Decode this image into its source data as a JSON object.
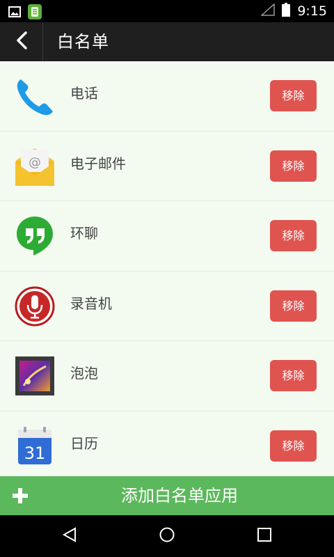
{
  "status_bar": {
    "time": "9:15",
    "left_icons": [
      "image-icon",
      "android-notification-icon"
    ],
    "right_icons": [
      "signal-icon",
      "battery-icon"
    ]
  },
  "title_bar": {
    "title": "白名单",
    "back_icon": "back-arrow-icon"
  },
  "apps": [
    {
      "name": "电话",
      "icon": "phone-icon",
      "remove_label": "移除"
    },
    {
      "name": "电子邮件",
      "icon": "email-icon",
      "remove_label": "移除"
    },
    {
      "name": "环聊",
      "icon": "hangouts-icon",
      "remove_label": "移除"
    },
    {
      "name": "录音机",
      "icon": "voice-recorder-icon",
      "remove_label": "移除"
    },
    {
      "name": "泡泡",
      "icon": "bubbles-icon",
      "remove_label": "移除"
    },
    {
      "name": "日历",
      "icon": "calendar-icon",
      "remove_label": "移除",
      "icon_text": "31"
    }
  ],
  "add_bar": {
    "label": "添加白名单应用",
    "icon": "plus-icon"
  },
  "nav_bar": {
    "icons": [
      "back-nav-icon",
      "home-nav-icon",
      "recents-nav-icon"
    ]
  },
  "colors": {
    "background": "#f3fbf1",
    "remove_button": "#e05450",
    "add_bar": "#5cb85c",
    "title_bar": "#1f1f1f"
  }
}
